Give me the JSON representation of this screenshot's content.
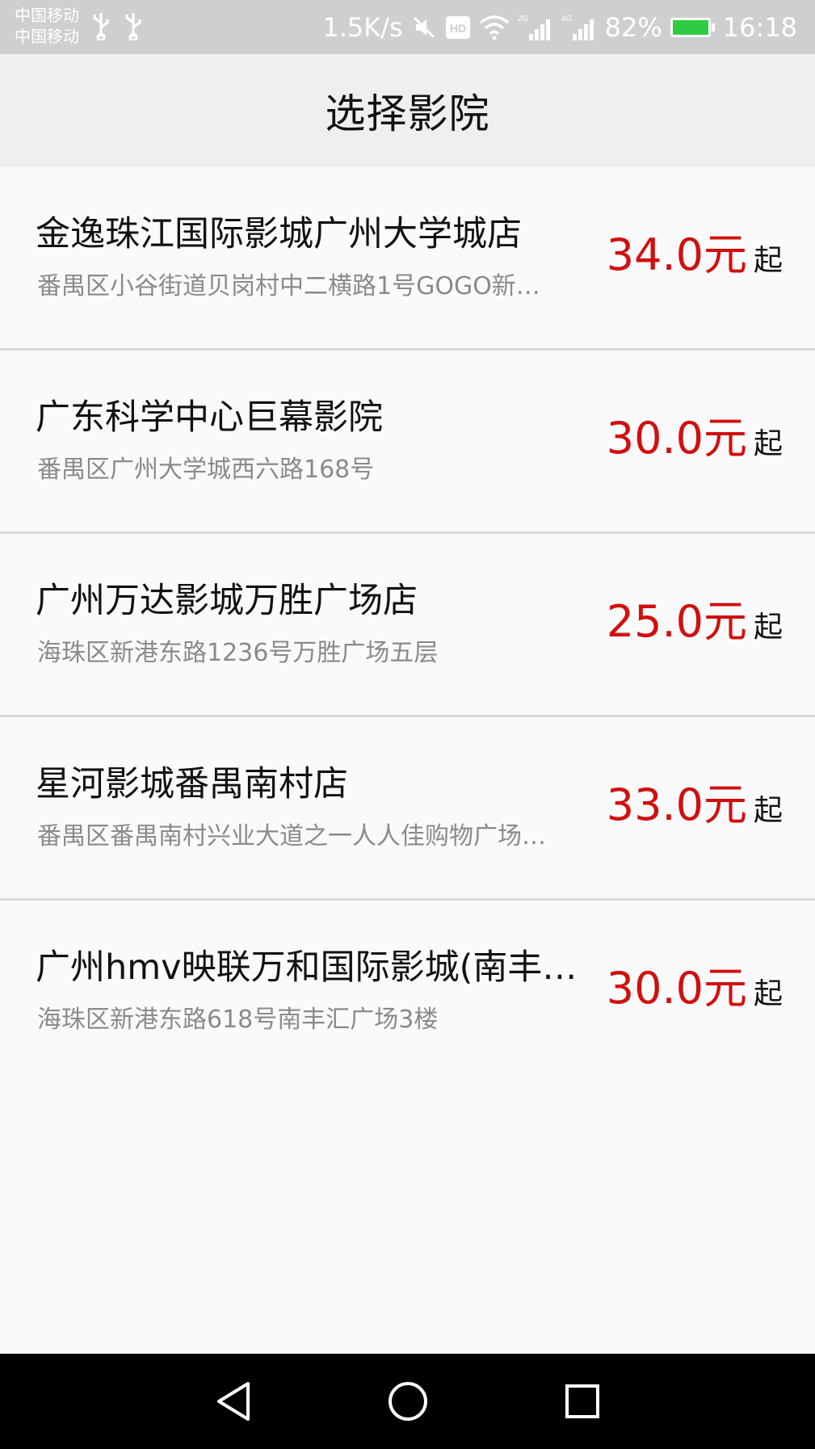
{
  "status_bar": {
    "carrier_1": "中国移动",
    "carrier_2": "中国移动",
    "net_speed": "1.5K/s",
    "signal_1_label": "2G",
    "signal_2_label": "4G",
    "battery": "82%",
    "time": "16:18",
    "icons": [
      "usb-icon",
      "usb-icon",
      "mute-icon",
      "hd-icon",
      "wifi-icon",
      "signal-icon",
      "signal-icon",
      "battery-charging-icon"
    ]
  },
  "header": {
    "title": "选择影院"
  },
  "cinemas": [
    {
      "name": "金逸珠江国际影城广州大学城店",
      "address": "番禺区小谷街道贝岗村中二横路1号GOGO新…",
      "price": "34.0元",
      "price_suffix": "起"
    },
    {
      "name": "广东科学中心巨幕影院",
      "address": "番禺区广州大学城西六路168号",
      "price": "30.0元",
      "price_suffix": "起"
    },
    {
      "name": "广州万达影城万胜广场店",
      "address": "海珠区新港东路1236号万胜广场五层",
      "price": "25.0元",
      "price_suffix": "起"
    },
    {
      "name": "星河影城番禺南村店",
      "address": "番禺区番禺南村兴业大道之一人人佳购物广场…",
      "price": "33.0元",
      "price_suffix": "起"
    },
    {
      "name": "广州hmv映联万和国际影城(南丰…",
      "address": "海珠区新港东路618号南丰汇广场3楼",
      "price": "30.0元",
      "price_suffix": "起"
    }
  ],
  "nav_bar": {
    "icons": [
      "back-icon",
      "home-icon",
      "recents-icon"
    ]
  },
  "colors": {
    "price": "#d10f0f",
    "header_bg": "#efefef",
    "status_bg": "#cfcfcf",
    "battery": "#2ecc40"
  }
}
